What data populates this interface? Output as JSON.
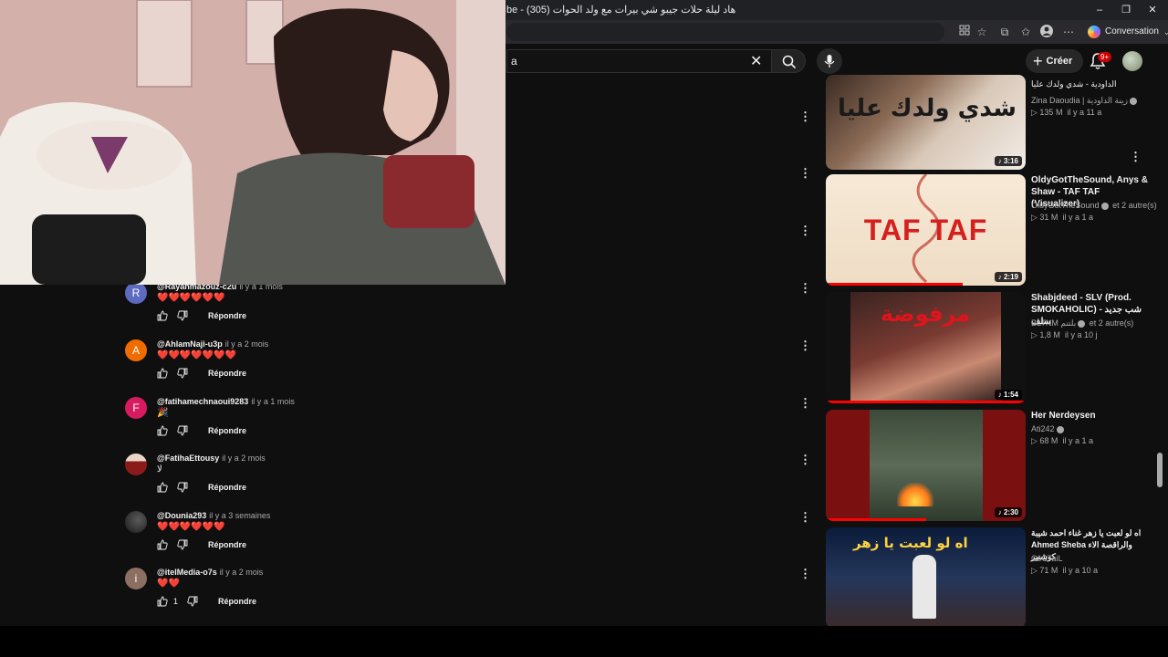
{
  "browser": {
    "tab_title": "be - هاد ليلة حلات جيبو شي بيرات مع ولد الحوات (305)",
    "conversation_label": "Conversation",
    "min_glyph": "–",
    "max_glyph": "❐",
    "close_glyph": "✕"
  },
  "youtube_header": {
    "search_value": "a",
    "clear_glyph": "✕",
    "create_label": "Créer",
    "create_glyph": "+",
    "notifications_badge": "9+"
  },
  "comments": [
    {
      "avatar_letter": "R",
      "avatar_color": "#5c6bc0",
      "author": "@Rayanmazouz-c2u",
      "time": "il y a 1 mois",
      "text": "❤️❤️❤️❤️❤️❤️",
      "likes": "",
      "reply_label": "Répondre"
    },
    {
      "avatar_letter": "A",
      "avatar_color": "#ef6c00",
      "author": "@AhlamNaji-u3p",
      "time": "il y a 2 mois",
      "text": "❤️❤️❤️❤️❤️❤️❤️",
      "likes": "",
      "reply_label": "Répondre"
    },
    {
      "avatar_letter": "F",
      "avatar_color": "#d81b60",
      "author": "@fatihamechnaoui9283",
      "time": "il y a 1 mois",
      "text": "🎉",
      "likes": "",
      "reply_label": "Répondre"
    },
    {
      "avatar_letter": "",
      "avatar_color": "#8b3a3a",
      "author": "@FatihaEttousy",
      "time": "il y a 2 mois",
      "text": "لا",
      "likes": "",
      "reply_label": "Répondre"
    },
    {
      "avatar_letter": "",
      "avatar_color": "#2d2d2d",
      "author": "@Dounia293",
      "time": "il y a 3 semaines",
      "text": "❤️❤️❤️❤️❤️❤️",
      "likes": "",
      "reply_label": "Répondre"
    },
    {
      "avatar_letter": "i",
      "avatar_color": "#8d6e63",
      "author": "@itelMedia-o7s",
      "time": "il y a 2 mois",
      "text": "❤️❤️",
      "likes": "1",
      "reply_label": "Répondre"
    }
  ],
  "recommendations": [
    {
      "title": "الداودية - شدي ولدك عليا",
      "thumb_text": "شدي ولدك عليا",
      "channel": "Zina Daoudia | زينة الداودية",
      "views": "135 M",
      "age": "il y a 11 a",
      "duration": "3:16",
      "progress": 0.9
    },
    {
      "title": "OldyGotTheSound, Anys & Shaw - TAF TAF (Visualizer)",
      "thumb_text": "TAF TAF",
      "channel": "OldyGotTheSound",
      "channel_extra": "et 2 autre(s)",
      "views": "31 M",
      "age": "il y a 1 a",
      "duration": "2:19",
      "progress": 0.6
    },
    {
      "title": "Shabjdeed - SLV (Prod. SMOKAHOLIC) شب جديد - سلف",
      "thumb_text": "مرفوضة",
      "channel": "BLTNM بلتنم",
      "channel_extra": "et 2 autre(s)",
      "views": "1,8 M",
      "age": "il y a 10 j",
      "duration": "1:54",
      "progress": 1.0
    },
    {
      "title": "Her Nerdeysen",
      "thumb_text": "",
      "channel": "Ati242",
      "channel_extra": "",
      "views": "68 M",
      "age": "il y a 1 a",
      "duration": "2:30",
      "progress": 0.5
    },
    {
      "title": "اه لو لعبت يا زهر غناء احمد شيبة Ahmed Sheba والراقصة الاء كوشنير",
      "thumb_text": "اه لو لعبت يا زهر",
      "channel": "CoCTaiL",
      "channel_extra": "",
      "views": "71 M",
      "age": "il y a 10 a",
      "duration": "",
      "progress": 0
    }
  ],
  "icons": {
    "like": "thumbs-up-icon",
    "dislike": "thumbs-down-icon",
    "more": "more-vert-icon",
    "search": "search-icon",
    "mic": "mic-icon",
    "bell": "bell-icon",
    "music": "music-note-icon",
    "views": "play-icon"
  }
}
